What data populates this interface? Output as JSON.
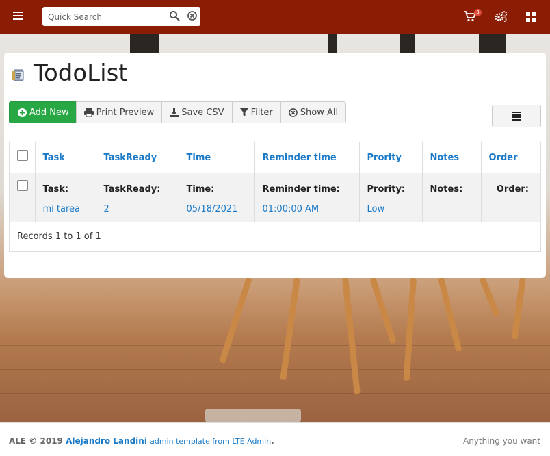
{
  "search": {
    "placeholder": "Quick Search"
  },
  "nav": {
    "cart_count": "3"
  },
  "page": {
    "title": "TodoList"
  },
  "toolbar": {
    "add_label": "Add New",
    "print_label": "Print Preview",
    "csv_label": "Save CSV",
    "filter_label": "Filter",
    "showall_label": "Show All"
  },
  "table": {
    "headers": [
      "Task",
      "TaskReady",
      "Time",
      "Reminder time",
      "Prority",
      "Notes",
      "Order"
    ],
    "row": {
      "labels": [
        "Task:",
        "TaskReady:",
        "Time:",
        "Reminder time:",
        "Prority:",
        "Notes:",
        "Order:"
      ],
      "values": [
        "mi tarea",
        "2",
        "05/18/2021",
        "01:00:00 AM",
        "Low",
        "",
        ""
      ]
    },
    "records": "Records 1 to 1 of 1"
  },
  "footer": {
    "prefix": "ALE © 2019 ",
    "author": "Alejandro Landini",
    "template": "admin template from LTE Admin",
    "suffix": ".",
    "right": "Anything you want"
  },
  "colors": {
    "navbar": "#8b1d05",
    "accent": "#1a7ac8",
    "add_button": "#28a745",
    "badge": "#dd4b39"
  }
}
